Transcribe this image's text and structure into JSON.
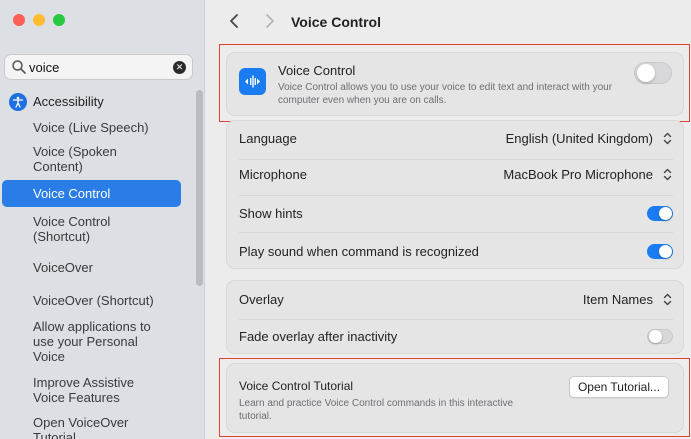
{
  "sidebar": {
    "search": {
      "value": "voice"
    },
    "category": "Accessibility",
    "items": [
      {
        "label": "Voice (Live Speech)"
      },
      {
        "label": "Voice (Spoken Content)"
      },
      {
        "label": "Voice Control"
      },
      {
        "label": "Voice Control (Shortcut)"
      },
      {
        "label": "VoiceOver"
      },
      {
        "label": "VoiceOver (Shortcut)"
      },
      {
        "label": "Allow applications to use your Personal Voice"
      },
      {
        "label": "Improve Assistive Voice Features"
      },
      {
        "label": "Open VoiceOver Tutorial"
      }
    ],
    "selected_index": 2
  },
  "header": {
    "title": "Voice Control"
  },
  "voice_control_card": {
    "title": "Voice Control",
    "description": "Voice Control allows you to use your voice to edit text and interact with your computer even when you are on calls.",
    "enabled": false
  },
  "settings": {
    "language": {
      "label": "Language",
      "value": "English (United Kingdom)"
    },
    "microphone": {
      "label": "Microphone",
      "value": "MacBook Pro Microphone"
    },
    "show_hints": {
      "label": "Show hints",
      "enabled": true
    },
    "play_sound": {
      "label": "Play sound when command is recognized",
      "enabled": true
    },
    "overlay": {
      "label": "Overlay",
      "value": "Item Names"
    },
    "fade_overlay": {
      "label": "Fade overlay after inactivity",
      "enabled": false
    }
  },
  "tutorial": {
    "title": "Voice Control Tutorial",
    "description": "Learn and practice Voice Control commands in this interactive tutorial.",
    "button_label": "Open Tutorial..."
  },
  "colors": {
    "accent": "#1a7cf0",
    "selection": "#2a7ce6",
    "highlight_border": "#e0422e"
  }
}
